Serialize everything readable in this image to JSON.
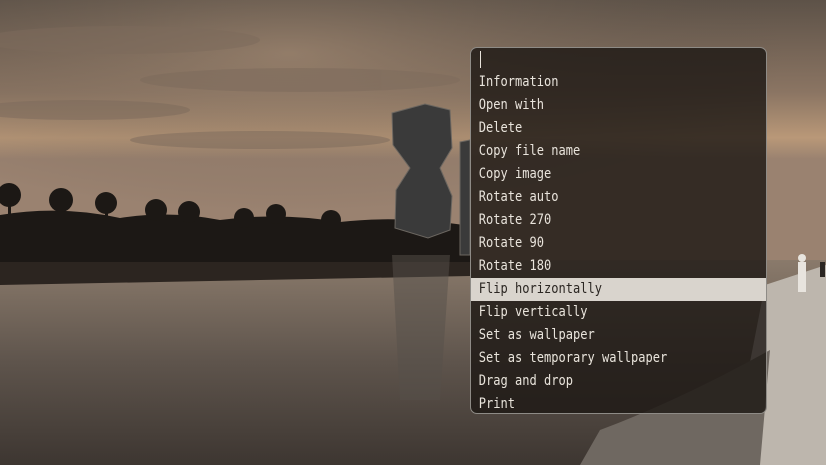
{
  "search": {
    "value": "",
    "placeholder": ""
  },
  "menu": {
    "items": [
      {
        "label": "Information"
      },
      {
        "label": "Open with"
      },
      {
        "label": "Delete"
      },
      {
        "label": "Copy file name"
      },
      {
        "label": "Copy image"
      },
      {
        "label": "Rotate auto"
      },
      {
        "label": "Rotate 270"
      },
      {
        "label": "Rotate 90"
      },
      {
        "label": "Rotate 180"
      },
      {
        "label": "Flip horizontally",
        "selected": true
      },
      {
        "label": "Flip vertically"
      },
      {
        "label": "Set as wallpaper"
      },
      {
        "label": "Set as temporary wallpaper"
      },
      {
        "label": "Drag and drop"
      },
      {
        "label": "Print"
      }
    ]
  },
  "colors": {
    "menu_background": "#1c1613",
    "menu_border": "#8e8b86",
    "menu_text": "#e9e4dc",
    "selected_background": "#d9d4cd",
    "selected_text": "#2b2622"
  }
}
